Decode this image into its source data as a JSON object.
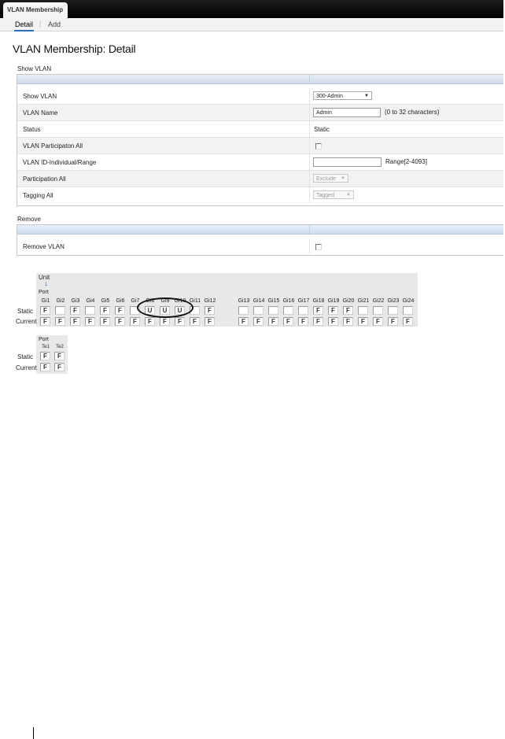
{
  "header": {
    "tab_active": "VLAN Membership"
  },
  "subnav": {
    "detail": "Detail",
    "separator": "|",
    "add": "Add"
  },
  "page_title": "VLAN Membership: Detail",
  "show_vlan_section": {
    "title": "Show VLAN",
    "rows": {
      "show_vlan": {
        "label": "Show VLAN",
        "value": "300-Admin"
      },
      "vlan_name": {
        "label": "VLAN Name",
        "value": "Admin",
        "hint": "(0 to 32 characters)"
      },
      "status": {
        "label": "Status",
        "value": "Static"
      },
      "participation_all_chk": {
        "label": "VLAN Participaton All"
      },
      "vlan_id_range": {
        "label": "VLAN ID-Individual/Range",
        "value": "",
        "hint": "Range[2-4093]"
      },
      "participation_all": {
        "label": "Participation All",
        "value": "Exclude"
      },
      "tagging_all": {
        "label": "Tagging All",
        "value": "Tagged"
      }
    }
  },
  "remove_section": {
    "title": "Remove",
    "row_label": "Remove VLAN"
  },
  "port_grid": {
    "unit_label": "Unit",
    "unit_number": "1",
    "port_label": "Port",
    "static_label": "Static",
    "current_label": "Current",
    "ports": [
      "Gi1",
      "Gi2",
      "Gi3",
      "Gi4",
      "Gi5",
      "Gi6",
      "Gi7",
      "Gi8",
      "Gi9",
      "Gi10",
      "Gi11",
      "Gi12",
      "Gi13",
      "Gi14",
      "Gi15",
      "Gi16",
      "Gi17",
      "Gi18",
      "Gi19",
      "Gi20",
      "Gi21",
      "Gi22",
      "Gi23",
      "Gi24"
    ],
    "static": [
      "F",
      "",
      "F",
      "",
      "F",
      "F",
      "",
      "U",
      "U",
      "U",
      "",
      "F",
      "",
      "",
      "",
      "",
      "",
      "F",
      "F",
      "F",
      "",
      "",
      "",
      ""
    ],
    "current": [
      "F",
      "F",
      "F",
      "F",
      "F",
      "F",
      "F",
      "F",
      "F",
      "F",
      "F",
      "F",
      "F",
      "F",
      "F",
      "F",
      "F",
      "F",
      "F",
      "F",
      "F",
      "F",
      "F",
      "F"
    ]
  },
  "te_grid": {
    "port_label": "Port",
    "static_label": "Static",
    "current_label": "Current",
    "ports": [
      "Te1",
      "Te2"
    ],
    "static": [
      "F",
      "F"
    ],
    "current": [
      "F",
      "F"
    ]
  }
}
